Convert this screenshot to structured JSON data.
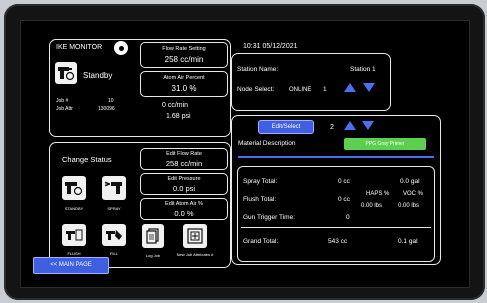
{
  "bezel_color": "#141414",
  "accent_blue": "#4c6ff0",
  "monitor": {
    "title": "IKE MONITOR",
    "settings_icon": "gear-icon",
    "gun_status": "Standby",
    "job_label": "Job #",
    "job_value": "10",
    "job_attr_label": "Job Attr",
    "job_attr_value": "130096",
    "flow_rate_title": "Flow Rate Setting",
    "flow_rate_value": "258 cc/min",
    "atom_air_title": "Atom Air Percent",
    "atom_air_value": "31.0 %",
    "actual_flow": "0 cc/min",
    "actual_pressure": "1.68 psi"
  },
  "change_status": {
    "title": "Change Status",
    "buttons": [
      {
        "label": "STANDBY",
        "icon": "spray-gun-standby-icon"
      },
      {
        "label": "SPRAY",
        "icon": "spray-gun-spray-icon"
      },
      {
        "label": "FLUSH",
        "icon": "flush-icon"
      },
      {
        "label": "FILL",
        "icon": "fill-icon"
      },
      {
        "label": "Log Job",
        "icon": "log-job-icon"
      },
      {
        "label": "New Job Attributes #",
        "icon": "new-job-icon"
      }
    ],
    "edit_flow_rate_title": "Edit Flow Rate",
    "edit_flow_rate_value": "258 cc/min",
    "edit_pressure_title": "Edit Pressure",
    "edit_pressure_value": "0.0 psi",
    "edit_atom_title": "Edit Atom Air %",
    "edit_atom_value": "0.0 %"
  },
  "station": {
    "datetime": "10:31 05/12/2021",
    "name_label": "Station Name:",
    "name_value": "Station 1",
    "node_label": "Node Select:",
    "node_status": "ONLINE",
    "node_number": "1"
  },
  "material": {
    "edit_select_label": "Edit/Select",
    "index": "2",
    "description_label": "Material Description",
    "material_name": "PPG Gray Primer",
    "material_color": "#5ccf4f"
  },
  "totals": {
    "spray_label": "Spray Total:",
    "spray_cc": "0 cc",
    "spray_gal": "0.0 gal",
    "flush_label": "Flush Total:",
    "flush_cc": "0 cc",
    "haps_label": "HAPS %",
    "haps_value": "0.00 lbs",
    "voc_label": "VOC %",
    "voc_value": "0.00 lbs",
    "trigger_label": "Gun Trigger Time:",
    "trigger_value": "0",
    "grand_label": "Grand Total:",
    "grand_cc": "543 cc",
    "grand_gal": "0.1 gal"
  },
  "nav": {
    "main_page_label": "<< MAIN PAGE"
  }
}
